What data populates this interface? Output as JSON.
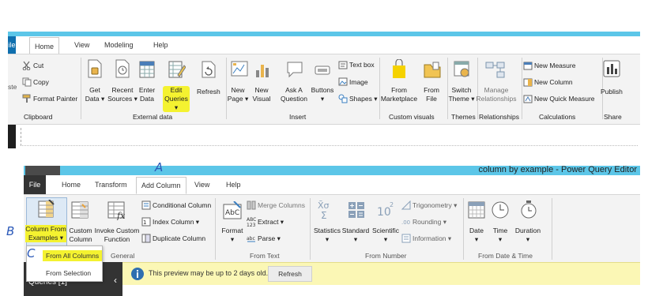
{
  "top": {
    "tabs": [
      "ile",
      "Home",
      "View",
      "Modeling",
      "Help"
    ],
    "clipboard": {
      "cut": "Cut",
      "copy": "Copy",
      "paste_partial": "ste",
      "format_painter": "Format Painter",
      "label": "Clipboard"
    },
    "external_data": {
      "get_data": [
        "Get",
        "Data ▾"
      ],
      "recent_sources": [
        "Recent",
        "Sources ▾"
      ],
      "enter_data": [
        "Enter",
        "Data"
      ],
      "edit_queries": [
        "Edit",
        "Queries ▾"
      ],
      "refresh": "Refresh",
      "label": "External data"
    },
    "insert": {
      "new_page": [
        "New",
        "Page ▾"
      ],
      "new_visual": [
        "New",
        "Visual"
      ],
      "ask_question": [
        "Ask A",
        "Question"
      ],
      "buttons": [
        "Buttons",
        "▾"
      ],
      "text_box": "Text box",
      "image": "Image",
      "shapes": "Shapes ▾",
      "label": "Insert"
    },
    "custom_visuals": {
      "from_marketplace": [
        "From",
        "Marketplace"
      ],
      "from_file": [
        "From",
        "File"
      ],
      "label": "Custom visuals"
    },
    "themes": {
      "switch_theme": [
        "Switch",
        "Theme ▾"
      ],
      "label": "Themes"
    },
    "relationships": {
      "manage": [
        "Manage",
        "Relationships"
      ],
      "label": "Relationships"
    },
    "calculations": {
      "new_measure": "New Measure",
      "new_column": "New Column",
      "new_quick_measure": "New Quick Measure",
      "label": "Calculations"
    },
    "share": {
      "publish": "Publish",
      "label": "Share"
    }
  },
  "bottom": {
    "title": "column by example - Power Query Editor",
    "tabs": [
      "File",
      "Home",
      "Transform",
      "Add Column",
      "View",
      "Help"
    ],
    "general": {
      "column_from_examples": [
        "Column From",
        "Examples ▾"
      ],
      "custom_column": [
        "Custom",
        "Column"
      ],
      "invoke_custom_function": [
        "Invoke Custom",
        "Function"
      ],
      "conditional_column": "Conditional Column",
      "index_column": "Index Column ▾",
      "duplicate_column": "Duplicate Column",
      "label": "General"
    },
    "from_text": {
      "format": [
        "Format",
        "▾"
      ],
      "merge_columns": "Merge Columns",
      "extract": "Extract ▾",
      "parse": "Parse ▾",
      "label": "From Text"
    },
    "from_number": {
      "statistics": [
        "Statistics",
        "▾"
      ],
      "standard": [
        "Standard",
        "▾"
      ],
      "scientific": [
        "Scientific",
        "▾"
      ],
      "trigonometry": "Trigonometry ▾",
      "rounding": "Rounding ▾",
      "information": "Information ▾",
      "label": "From Number"
    },
    "from_date_time": {
      "date": [
        "Date",
        "▾"
      ],
      "time": [
        "Time",
        "▾"
      ],
      "duration": [
        "Duration",
        "▾"
      ],
      "label": "From Date & Time"
    },
    "dropdown": {
      "from_all_columns": "From All Columns",
      "from_selection": "From Selection"
    },
    "queries_label": "Queries [1]",
    "message": "This preview may be up to 2 days old.",
    "refresh_button": "Refresh"
  },
  "annotations": {
    "a": "A",
    "b": "B",
    "c": "C"
  },
  "colors": {
    "title_bar": "#5cc6e8",
    "highlight": "#f4f230",
    "message_bar": "#fbf7b5",
    "annotation": "#2a58b8"
  }
}
